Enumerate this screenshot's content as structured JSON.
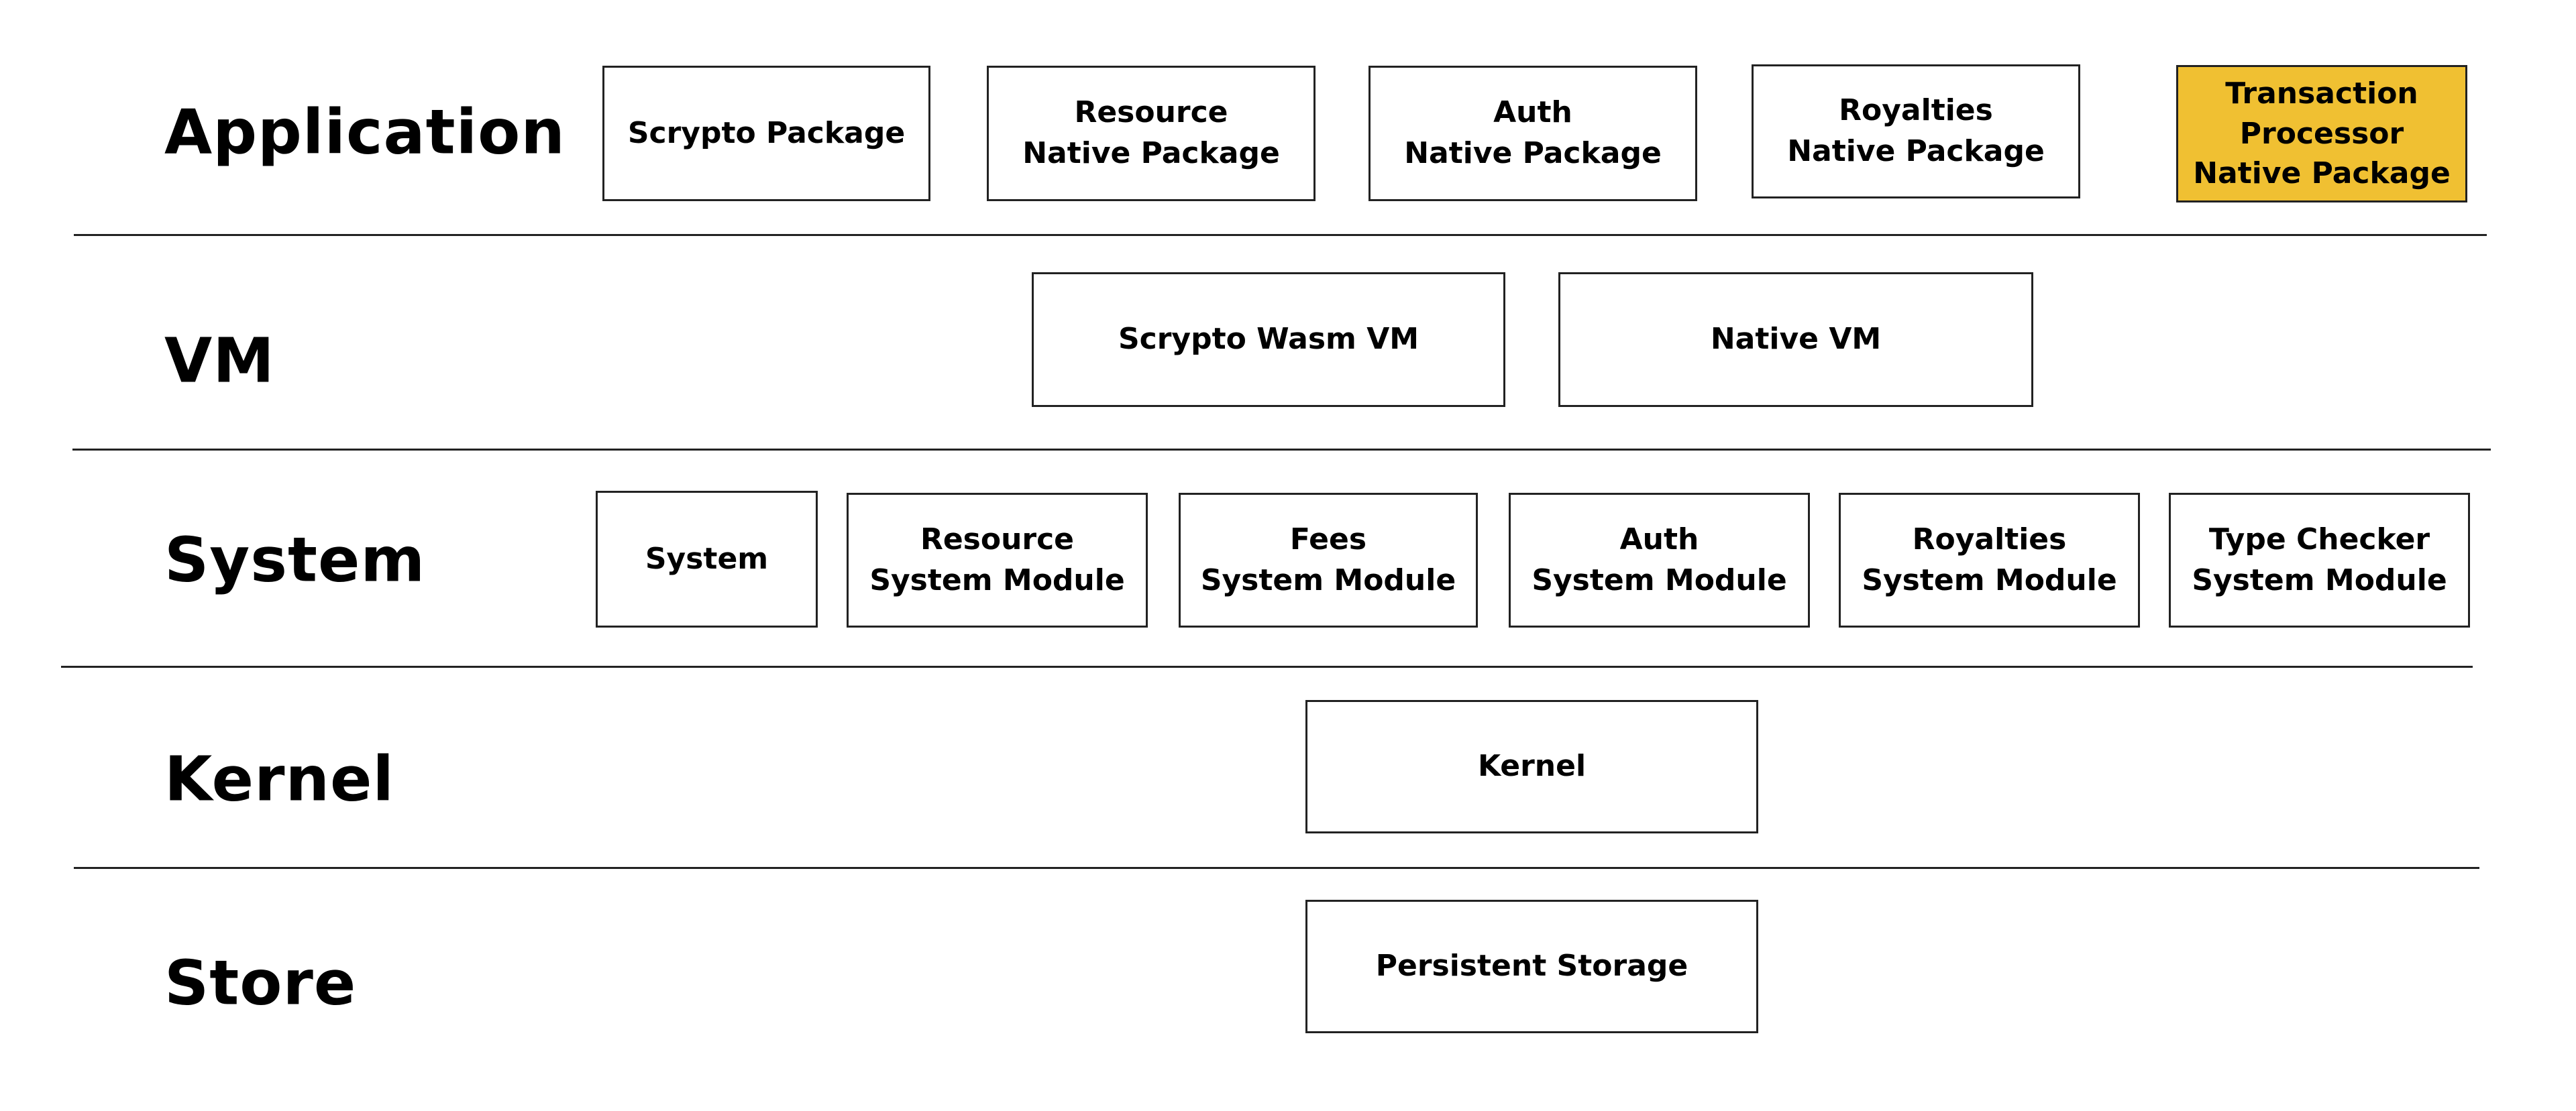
{
  "highlight_color": "#F0C032",
  "layers": [
    {
      "label": "Application",
      "boxes": [
        "Scrypto Package",
        "Resource\nNative Package",
        "Auth\nNative Package",
        "Royalties\nNative Package",
        "Transaction\nProcessor\nNative Package"
      ]
    },
    {
      "label": "VM",
      "boxes": [
        "Scrypto Wasm VM",
        "Native VM"
      ]
    },
    {
      "label": "System",
      "boxes": [
        "System",
        "Resource\nSystem Module",
        "Fees\nSystem Module",
        "Auth\nSystem Module",
        "Royalties\nSystem Module",
        "Type Checker\nSystem Module"
      ]
    },
    {
      "label": "Kernel",
      "boxes": [
        "Kernel"
      ]
    },
    {
      "label": "Store",
      "boxes": [
        "Persistent Storage"
      ]
    }
  ]
}
